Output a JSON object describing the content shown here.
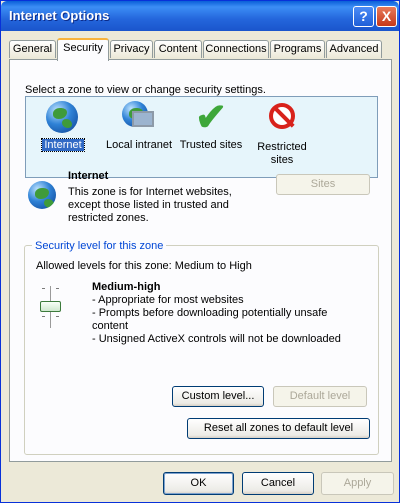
{
  "window": {
    "title": "Internet Options"
  },
  "titlebar_buttons": {
    "help": "?",
    "close": "X"
  },
  "tabs": [
    {
      "label": "General"
    },
    {
      "label": "Security"
    },
    {
      "label": "Privacy"
    },
    {
      "label": "Content"
    },
    {
      "label": "Connections"
    },
    {
      "label": "Programs"
    },
    {
      "label": "Advanced"
    }
  ],
  "security": {
    "prompt": "Select a zone to view or change security settings.",
    "zones": [
      {
        "label": "Internet",
        "icon": "globe-icon",
        "selected": true
      },
      {
        "label": "Local intranet",
        "icon": "computer-globe-icon"
      },
      {
        "label": "Trusted sites",
        "icon": "checkmark-icon"
      },
      {
        "label": "Restricted sites",
        "icon": "restricted-icon"
      }
    ],
    "zone_info": {
      "title": "Internet",
      "description": "This zone is for Internet websites, except those listed in trusted and restricted zones."
    },
    "sites_button": "Sites",
    "level_group": {
      "legend": "Security level for this zone",
      "allowed": "Allowed levels for this zone: Medium to High",
      "level_name": "Medium-high",
      "bullets": [
        "- Appropriate for most websites",
        "- Prompts before downloading potentially unsafe content",
        "- Unsigned ActiveX controls will not be downloaded"
      ],
      "custom_level_button": "Custom level...",
      "default_level_button": "Default level"
    },
    "reset_all_button": "Reset all zones to default level"
  },
  "footer": {
    "ok": "OK",
    "cancel": "Cancel",
    "apply": "Apply"
  }
}
